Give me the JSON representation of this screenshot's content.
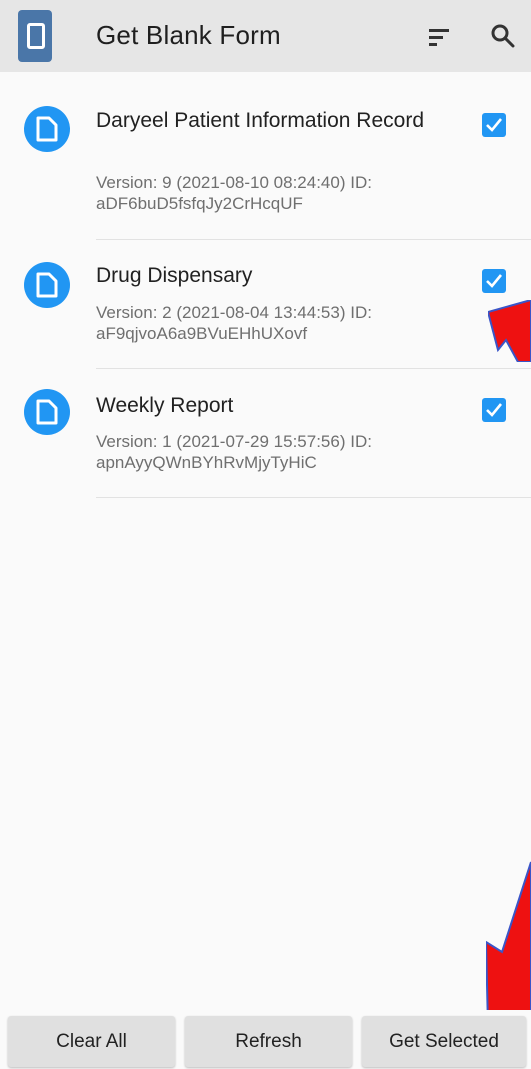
{
  "appbar": {
    "title": "Get Blank Form",
    "logo_icon": "odk-collect-logo",
    "sort_icon": "sort-icon",
    "search_icon": "search-icon"
  },
  "forms": [
    {
      "name": "Daryeel Patient Information Record",
      "meta": "Version: 9 (2021-08-10 08:24:40) ID: aDF6buD5fsfqJy2CrHcqUF",
      "checked": true
    },
    {
      "name": "Drug Dispensary",
      "meta": "Version: 2 (2021-08-04 13:44:53) ID: aF9qjvoA6a9BVuEHhUXovf",
      "checked": true
    },
    {
      "name": "Weekly Report",
      "meta": "Version: 1 (2021-07-29 15:57:56) ID: apnAyyQWnBYhRvMjyTyHiC",
      "checked": true
    }
  ],
  "buttons": {
    "clear_all": "Clear All",
    "refresh": "Refresh",
    "get_selected": "Get Selected"
  },
  "colors": {
    "accent": "#2196f3",
    "appbar_bg": "#e6e6e6",
    "annotation_arrow": "#ee1111"
  }
}
